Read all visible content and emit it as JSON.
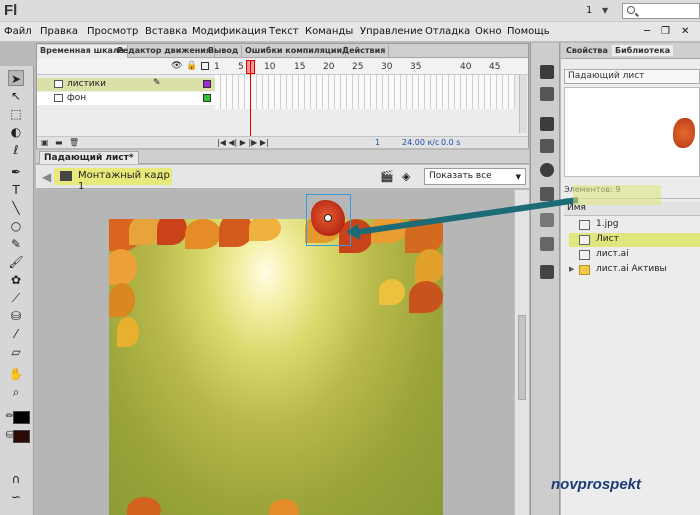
{
  "app": {
    "logo": "Fl",
    "workspace_num": "1"
  },
  "menu": [
    "Файл",
    "Правка",
    "Просмотр",
    "Вставка",
    "Модификация",
    "Текст",
    "Команды",
    "Управление",
    "Отладка",
    "Окно",
    "Помощь"
  ],
  "timeline": {
    "tabs": [
      "Временная шкала",
      "Редактор движения",
      "Вывод",
      "Ошибки компиляции",
      "Действия"
    ],
    "ruler": [
      "1",
      "5",
      "10",
      "15",
      "20",
      "25",
      "30",
      "35",
      "40",
      "45"
    ],
    "layers": [
      {
        "name": "листики"
      },
      {
        "name": "фон"
      }
    ],
    "footer": {
      "frame": "1",
      "fps": "24.00 к/с",
      "time": "0.0 s"
    }
  },
  "stage": {
    "tab": "Падающий лист*",
    "scene": "Монтажный кадр 1",
    "zoom": "Показать все"
  },
  "library": {
    "tabs": [
      "Свойства",
      "Библиотека"
    ],
    "selected_symbol": "Падающий лист",
    "count": "Элементов: 9",
    "col_header": "Имя",
    "items": [
      {
        "name": "1.jpg"
      },
      {
        "name": "Лист"
      },
      {
        "name": "лист.ai"
      },
      {
        "name": "лист.ai Активы"
      }
    ]
  },
  "watermark": "novprospekt",
  "colors": {
    "highlight": "#e0e57d",
    "arrow": "#1e6b78",
    "playhead": "#dd0000"
  }
}
